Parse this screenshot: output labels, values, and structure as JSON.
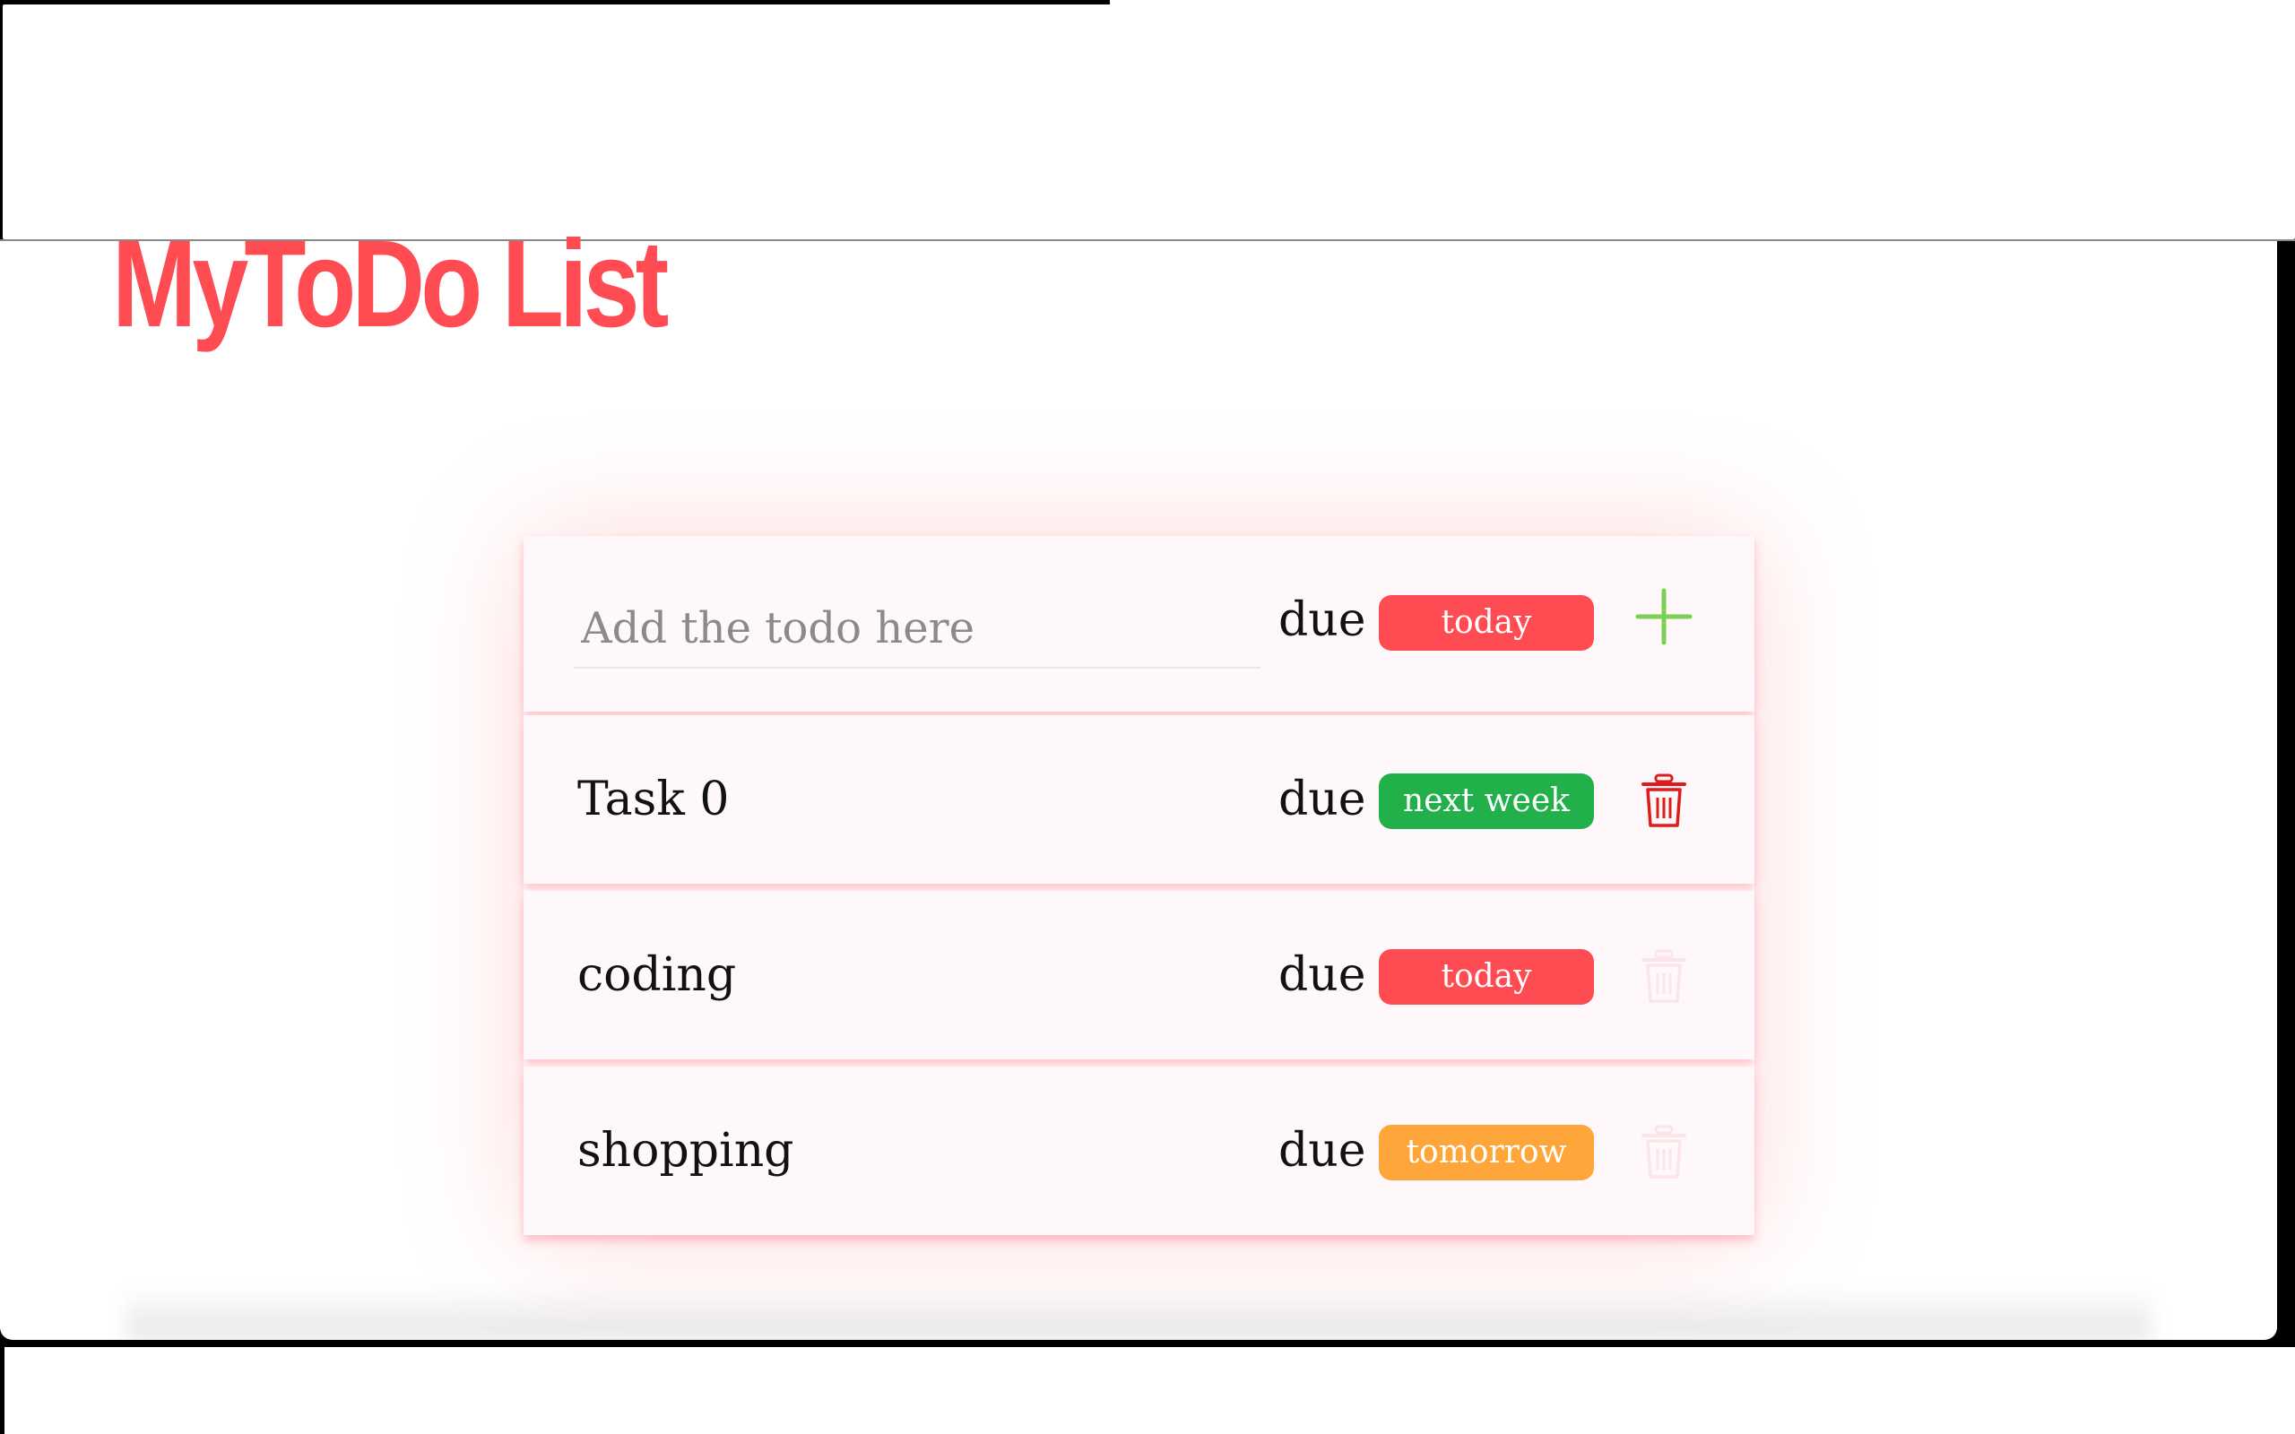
{
  "app": {
    "title": "MyToDo List"
  },
  "new_todo": {
    "placeholder": "Add the todo here",
    "value": "",
    "due_label": "due",
    "due_value": "today",
    "add_icon": "plus-icon"
  },
  "todos": [
    {
      "label": "Task 0",
      "due_label": "due",
      "due_value": "next week",
      "delete_icon": "trash-icon"
    },
    {
      "label": "coding",
      "due_label": "due",
      "due_value": "today",
      "delete_icon": "trash-icon"
    },
    {
      "label": "shopping",
      "due_label": "due",
      "due_value": "tomorrow",
      "delete_icon": "trash-icon"
    }
  ],
  "colors": {
    "accent": "#ff4b52",
    "today": "#ff4b52",
    "next_week": "#22b04b",
    "tomorrow": "#ffa63a",
    "add": "#7fcf55",
    "delete": "#e01a1a"
  }
}
